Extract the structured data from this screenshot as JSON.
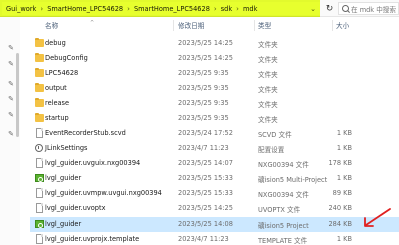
{
  "address_bar": {
    "crumbs": [
      "Gui_work",
      "SmartHome_LPC54628",
      "SmartHome_LPC54628",
      "sdk",
      "mdk"
    ],
    "search_placeholder": "在 mdk 中搜索"
  },
  "columns": {
    "name": "名称",
    "date": "修改日期",
    "type": "类型",
    "size": "大小"
  },
  "files": [
    {
      "name": "debug",
      "date": "2023/5/25 14:25",
      "type": "文件夹",
      "size": "",
      "icon": "folder-icon"
    },
    {
      "name": "DebugConfig",
      "date": "2023/5/25 14:25",
      "type": "文件夹",
      "size": "",
      "icon": "folder-icon"
    },
    {
      "name": "LPC54628",
      "date": "2023/5/25 9:35",
      "type": "文件夹",
      "size": "",
      "icon": "folder-icon"
    },
    {
      "name": "output",
      "date": "2023/5/25 9:35",
      "type": "文件夹",
      "size": "",
      "icon": "folder-icon"
    },
    {
      "name": "release",
      "date": "2023/5/25 9:35",
      "type": "文件夹",
      "size": "",
      "icon": "folder-icon"
    },
    {
      "name": "startup",
      "date": "2023/5/25 9:35",
      "type": "文件夹",
      "size": "",
      "icon": "folder-icon"
    },
    {
      "name": "EventRecorderStub.scvd",
      "date": "2023/5/24 17:52",
      "type": "SCVD 文件",
      "size": "1 KB",
      "icon": "document-icon"
    },
    {
      "name": "JLinkSettings",
      "date": "2023/4/7 11:23",
      "type": "配置设置",
      "size": "1 KB",
      "icon": "settings-file-icon"
    },
    {
      "name": "lvgl_guider.uvguix.nxg00394",
      "date": "2023/5/25 14:07",
      "type": "NXG00394 文件",
      "size": "178 KB",
      "icon": "document-icon"
    },
    {
      "name": "lvgl_guider",
      "date": "2023/5/25 15:33",
      "type": "礦ision5 Multi-Project",
      "size": "1 KB",
      "icon": "keil-project-icon"
    },
    {
      "name": "lvgl_guider.uvmpw.uvgui.nxg00394",
      "date": "2023/5/25 15:33",
      "type": "NXG00394 文件",
      "size": "89 KB",
      "icon": "document-icon"
    },
    {
      "name": "lvgl_guider.uvoptx",
      "date": "2023/5/25 14:25",
      "type": "UVOPTX 文件",
      "size": "240 KB",
      "icon": "document-icon"
    },
    {
      "name": "lvgl_guider",
      "date": "2023/5/25 14:08",
      "type": "礦ision5 Project",
      "size": "284 KB",
      "icon": "keil-project-icon",
      "selected": true
    },
    {
      "name": "lvgl_guider.uvprojx.template",
      "date": "2023/4/7 11:23",
      "type": "TEMPLATE 文件",
      "size": "1 KB",
      "icon": "document-icon"
    }
  ],
  "colors": {
    "highlighter": "#e2ff00",
    "selection": "#cce8ff",
    "folder": "#f3c244",
    "arrow": "#e02020"
  }
}
